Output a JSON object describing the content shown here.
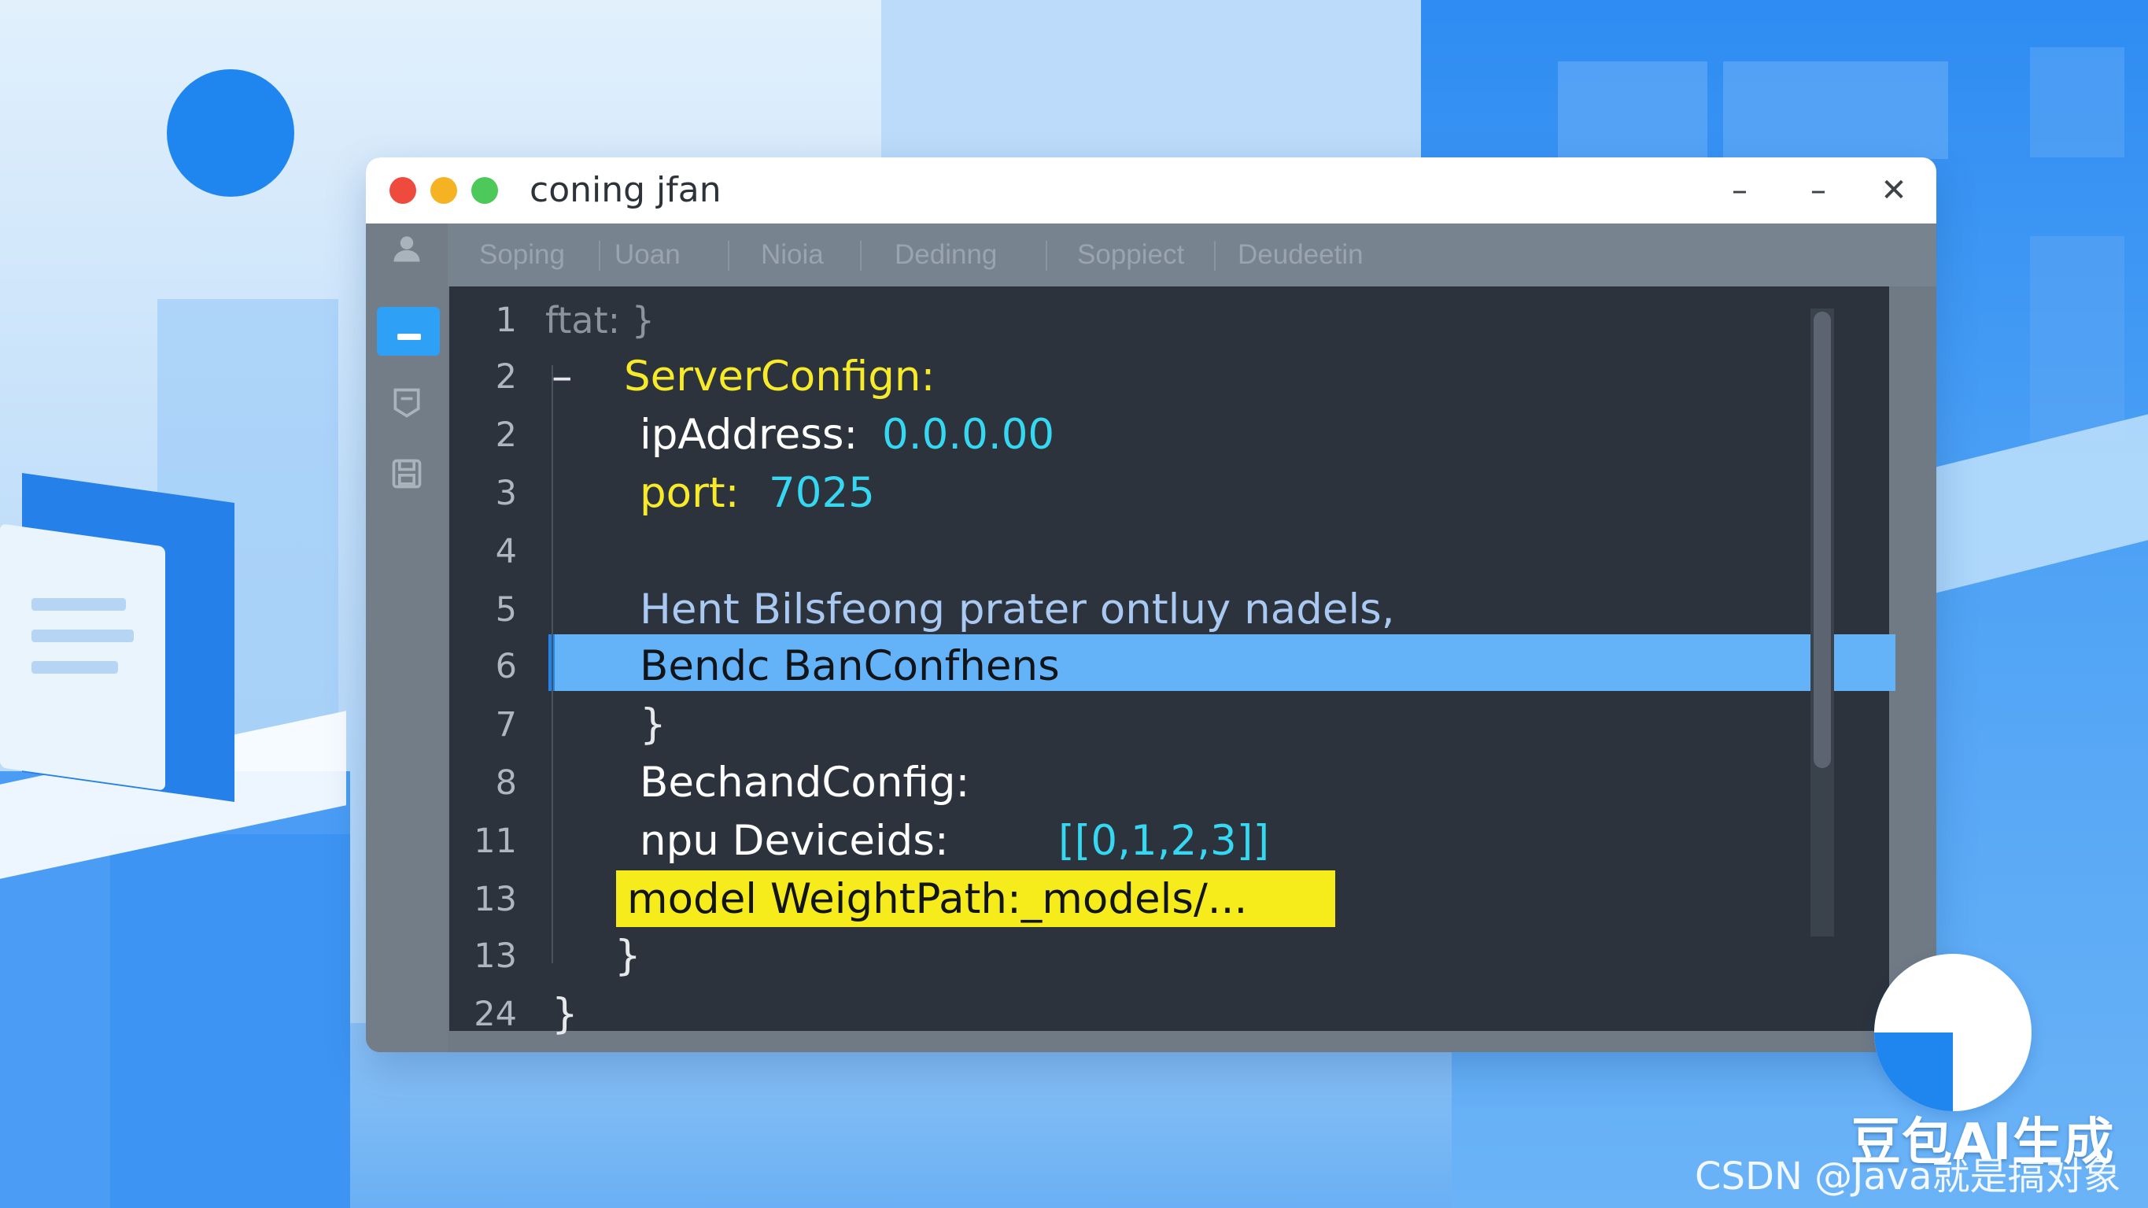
{
  "window": {
    "title": "coning jfan",
    "controls": {
      "minimize_1": "–",
      "minimize_2": "–",
      "close": "✕"
    }
  },
  "tabs": [
    {
      "label": "Soping"
    },
    {
      "label": "Uoan"
    },
    {
      "label": "Nioia"
    },
    {
      "label": "Dedinng"
    },
    {
      "label": "Soppiect"
    },
    {
      "label": "Deudeetin"
    }
  ],
  "sidebar": {
    "items": [
      {
        "icon": "user-icon"
      },
      {
        "icon": "files-icon",
        "active": true
      },
      {
        "icon": "comment-icon"
      },
      {
        "icon": "save-icon"
      }
    ]
  },
  "editor": {
    "lines": [
      {
        "number": "1",
        "text": "ftat: }"
      },
      {
        "number": "2",
        "prefix": "–",
        "key": "ServerConfign:"
      },
      {
        "number": "2",
        "key": "ipAddress:",
        "value": "0.0.0.00"
      },
      {
        "number": "3",
        "key": "port:",
        "value": "7025"
      },
      {
        "number": "4",
        "text": ""
      },
      {
        "number": "5",
        "text": "Hent Bilsfeong prater ontluy nadels,"
      },
      {
        "number": "6",
        "text": "Bendc BanConfhens",
        "highlighted": true
      },
      {
        "number": "7",
        "text": "}"
      },
      {
        "number": "8",
        "text": "BechandConfig:"
      },
      {
        "number": "11",
        "key": "npu Deviceids:",
        "value": "[[0,1,2,3]]"
      },
      {
        "number": "13",
        "text": "model WeightPath:_models/...",
        "yellow_highlight": true
      },
      {
        "number": "13",
        "text": "}"
      },
      {
        "number": "24",
        "text": "}"
      }
    ]
  },
  "watermark": {
    "main": "豆包AI生成",
    "sub": "CSDN @Java就是搞对象"
  },
  "colors": {
    "accent": "#1f86f0",
    "key_yellow": "#f7ea2a",
    "value_cyan": "#36d7f0",
    "editor_bg": "#2c333c",
    "selection_blue": "#64b2f7"
  }
}
